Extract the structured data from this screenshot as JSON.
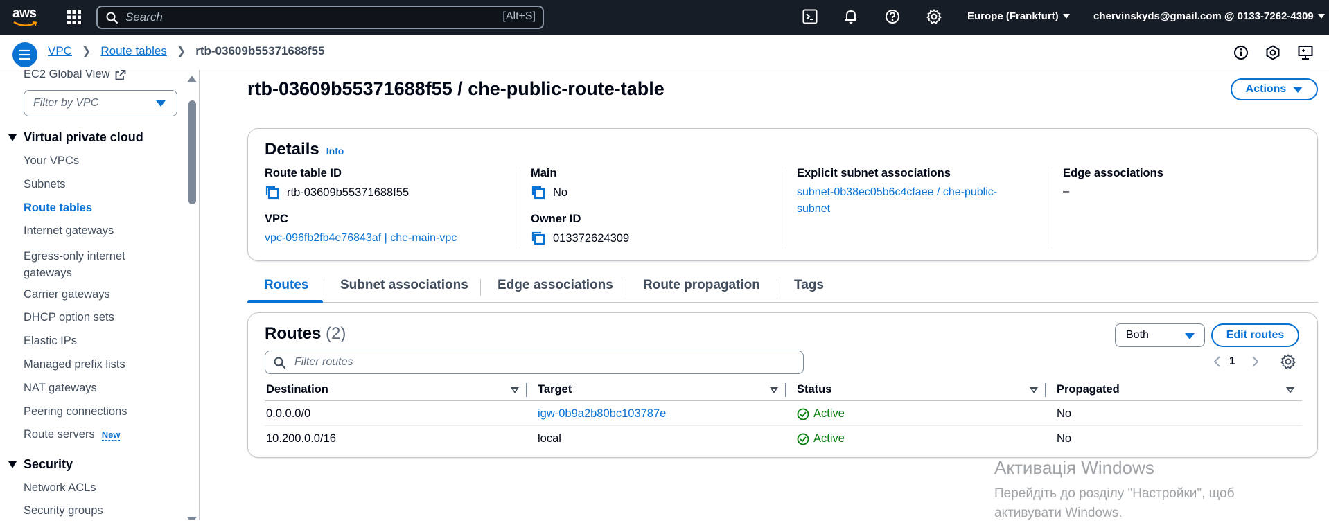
{
  "topbar": {
    "logo_text": "aws",
    "search_placeholder": "Search",
    "search_shortcut": "[Alt+S]",
    "region": "Europe (Frankfurt)",
    "account": "chervinskyds@gmail.com @ 0133-7262-4309"
  },
  "breadcrumb": {
    "items": [
      "VPC",
      "Route tables"
    ],
    "current": "rtb-03609b55371688f55"
  },
  "sidebar": {
    "top_link": "EC2 Global View",
    "filter_placeholder": "Filter by VPC",
    "section_vpc": "Virtual private cloud",
    "items": [
      "Your VPCs",
      "Subnets",
      "Route tables",
      "Internet gateways",
      "Egress-only internet gateways",
      "Carrier gateways",
      "DHCP option sets",
      "Elastic IPs",
      "Managed prefix lists",
      "NAT gateways",
      "Peering connections",
      "Route servers"
    ],
    "new_badge": "New",
    "section_security": "Security",
    "security_items": [
      "Network ACLs",
      "Security groups"
    ]
  },
  "page": {
    "title": "rtb-03609b55371688f55 / che-public-route-table",
    "actions_label": "Actions"
  },
  "details": {
    "title": "Details",
    "info_label": "Info",
    "route_table_id_label": "Route table ID",
    "route_table_id": "rtb-03609b55371688f55",
    "vpc_label": "VPC",
    "vpc_value": "vpc-096fb2fb4e76843af | che-main-vpc",
    "main_label": "Main",
    "main_value": "No",
    "owner_label": "Owner ID",
    "owner_value": "013372624309",
    "subnet_assoc_label": "Explicit subnet associations",
    "subnet_assoc_line1": "subnet-0b38ec05b6c4cfaee / che-public-",
    "subnet_assoc_line2": "subnet",
    "edge_assoc_label": "Edge associations",
    "edge_assoc_value": "–"
  },
  "tabs": [
    "Routes",
    "Subnet associations",
    "Edge associations",
    "Route propagation",
    "Tags"
  ],
  "routes": {
    "title": "Routes",
    "count": "(2)",
    "select_value": "Both",
    "edit_label": "Edit routes",
    "filter_placeholder": "Filter routes",
    "page": "1",
    "columns": [
      "Destination",
      "Target",
      "Status",
      "Propagated"
    ],
    "rows": [
      {
        "destination": "0.0.0.0/0",
        "target": "igw-0b9a2b80bc103787e",
        "status": "Active",
        "propagated": "No"
      },
      {
        "destination": "10.200.0.0/16",
        "target": "local",
        "status": "Active",
        "propagated": "No"
      }
    ]
  },
  "watermark": {
    "title": "Активація Windows",
    "line1": "Перейдіть до розділу \"Настройки\", щоб",
    "line2": "активувати Windows."
  },
  "colors": {
    "topbar_bg": "#161d26",
    "link_blue": "#0972d3",
    "status_green": "#037f0c"
  },
  "icons": [
    "grid-icon",
    "search-icon",
    "cloudshell-icon",
    "bell-icon",
    "help-icon",
    "settings-icon",
    "menu-icon",
    "info-icon",
    "notifications-icon",
    "feedback-icon",
    "external-link-icon",
    "copy-icon",
    "check-circle-icon",
    "chevron-left-icon",
    "chevron-right-icon",
    "gear-icon"
  ]
}
